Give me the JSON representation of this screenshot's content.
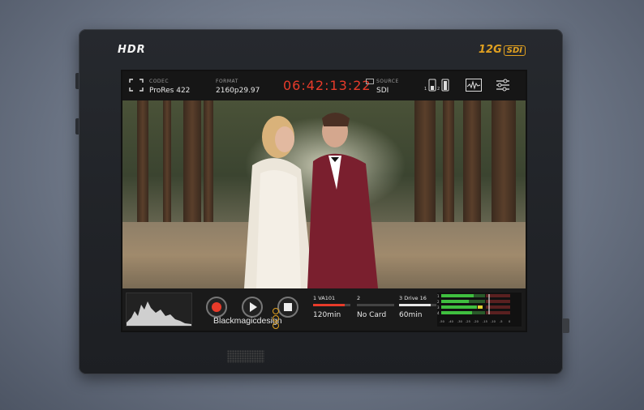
{
  "device": {
    "hdr_logo": "HDR",
    "sdi_logo_main": "12G",
    "sdi_logo_box": "SDI",
    "brand": "Blackmagicdesign"
  },
  "status_bar": {
    "codec_label": "CODEC",
    "codec_value": "ProRes 422",
    "format_label": "FORMAT",
    "format_value": "2160p29.97",
    "timecode": "06:42:13:22",
    "source_label": "SOURCE",
    "source_value": "SDI",
    "battery_1": "1",
    "battery_2": "2"
  },
  "media_slots": [
    {
      "index": "1",
      "name": "VA101",
      "value": "120min",
      "fill": 0.85,
      "color": "#e83b2a"
    },
    {
      "index": "2",
      "name": "",
      "value": "No Card",
      "fill": 0,
      "color": "#555555"
    },
    {
      "index": "3",
      "name": "Drive 16",
      "value": "60min",
      "fill": 0.85,
      "color": "#e8e8e8"
    }
  ],
  "meters": {
    "scale": [
      "-50",
      "-40",
      "-30",
      "-25",
      "-20",
      "-15",
      "-10",
      "-5",
      "0"
    ],
    "channels": [
      "1",
      "2",
      "3",
      "4"
    ]
  },
  "colors": {
    "record": "#e83b2a",
    "accent": "#e0a020",
    "meter_green": "#3fbf3f"
  }
}
